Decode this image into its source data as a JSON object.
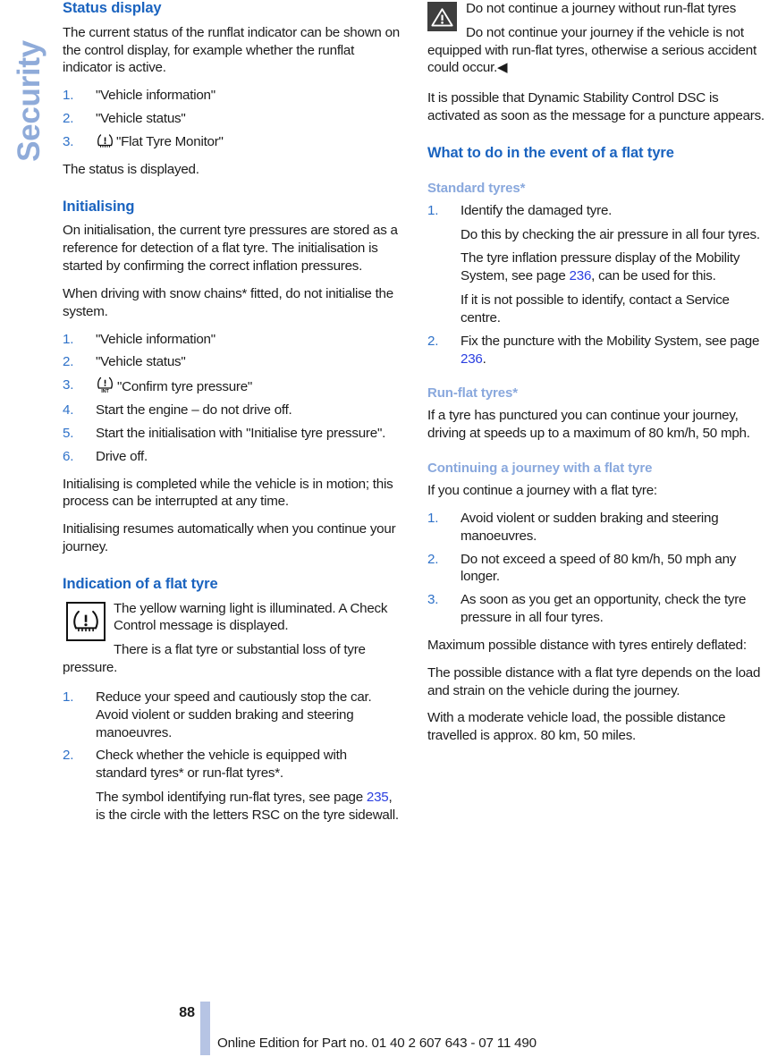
{
  "sidebar": {
    "tab_label": "Security"
  },
  "left_column": {
    "status_display": {
      "heading": "Status display",
      "intro": "The current status of the runflat indicator can be shown on the control display, for example whether the runflat indicator is active.",
      "steps": [
        {
          "num": "1.",
          "text": "\"Vehicle information\""
        },
        {
          "num": "2.",
          "text": "\"Vehicle status\""
        },
        {
          "num": "3.",
          "icon": "tyre-pressure-icon",
          "text": "\"Flat Tyre Monitor\""
        }
      ],
      "outro": "The status is displayed."
    },
    "initialising": {
      "heading": "Initialising",
      "para1": "On initialisation, the current tyre pressures are stored as a reference for detection of a flat tyre. The initialisation is started by confirming the correct inflation pressures.",
      "para2": "When driving with snow chains* fitted, do not initialise the system.",
      "steps": [
        {
          "num": "1.",
          "text": "\"Vehicle information\""
        },
        {
          "num": "2.",
          "text": "\"Vehicle status\""
        },
        {
          "num": "3.",
          "icon": "tyre-pressure-init-icon",
          "text": "\"Confirm tyre pressure\""
        },
        {
          "num": "4.",
          "text": "Start the engine – do not drive off."
        },
        {
          "num": "5.",
          "text": "Start the initialisation with \"Initialise tyre pressure\"."
        },
        {
          "num": "6.",
          "text": "Drive off."
        }
      ],
      "para3": "Initialising is completed while the vehicle is in motion; this process can be interrupted at any time.",
      "para4": "Initialising resumes automatically when you continue your journey."
    },
    "indication": {
      "heading": "Indication of a flat tyre",
      "callout_icon": "tyre-pressure-warning-light-icon",
      "callout_line1": "The yellow warning light is illuminated. A Check Control message is displayed.",
      "callout_line2": "There is a flat tyre or substantial loss of tyre pressure.",
      "steps": [
        {
          "num": "1.",
          "text": "Reduce your speed and cautiously stop the car. Avoid violent or sudden braking and steering manoeuvres."
        },
        {
          "num": "2.",
          "text": "Check whether the vehicle is equipped with standard tyres* or run-flat tyres*.",
          "sub_pre": "The symbol identifying run-flat tyres, see page ",
          "sub_page": "235",
          "sub_post": ", is the circle with the letters RSC on the tyre sidewall."
        }
      ]
    }
  },
  "right_column": {
    "warning": {
      "icon": "warning-triangle-icon",
      "title": "Do not continue a journey without run-flat tyres",
      "body": "Do not continue your journey if the vehicle is not equipped with run-flat tyres, otherwise a serious accident could occur.◀"
    },
    "dsc_note": "It is possible that Dynamic Stability Control DSC is activated as soon as the message for a puncture appears.",
    "what_to_do": {
      "heading": "What to do in the event of a flat tyre"
    },
    "standard_tyres": {
      "heading": "Standard tyres*",
      "step1_num": "1.",
      "step1_text": "Identify the damaged tyre.",
      "step1_sub1": "Do this by checking the air pressure in all four tyres.",
      "step1_sub2_pre": "The tyre inflation pressure display of the Mobility System, see page ",
      "step1_sub2_page": "236",
      "step1_sub2_post": ", can be used for this.",
      "step1_sub3": "If it is not possible to identify, contact a Service centre.",
      "step2_num": "2.",
      "step2_pre": "Fix the puncture with the Mobility System, see page ",
      "step2_page": "236",
      "step2_post": "."
    },
    "run_flat_tyres": {
      "heading": "Run-flat tyres*",
      "body": "If a tyre has punctured you can continue your journey, driving at speeds up to a maximum of 80 km/h, 50 mph."
    },
    "continuing": {
      "heading": "Continuing a journey with a flat tyre",
      "intro": "If you continue a journey with a flat tyre:",
      "steps": [
        {
          "num": "1.",
          "text": "Avoid violent or sudden braking and steering manoeuvres."
        },
        {
          "num": "2.",
          "text": "Do not exceed a speed of 80 km/h, 50 mph any longer."
        },
        {
          "num": "3.",
          "text": "As soon as you get an opportunity, check the tyre pressure in all four tyres."
        }
      ],
      "max_distance_label": "Maximum possible distance with tyres entirely deflated:",
      "para1": "The possible distance with a flat tyre depends on the load and strain on the vehicle during the journey.",
      "para2": "With a moderate vehicle load, the possible distance travelled is approx. 80 km, 50 miles."
    }
  },
  "footer": {
    "page_number": "88",
    "online_edition": "Online Edition for Part no. 01 40 2 607 643 - 07 11 490"
  },
  "colors": {
    "heading_blue": "#1a63bf",
    "subheading_blue": "#89a8dd",
    "list_number_blue": "#2f72c9",
    "page_ref_blue": "#2b3fe0",
    "side_tab_blue": "#8fabd9",
    "footer_bar_blue": "#b6c4e4"
  }
}
